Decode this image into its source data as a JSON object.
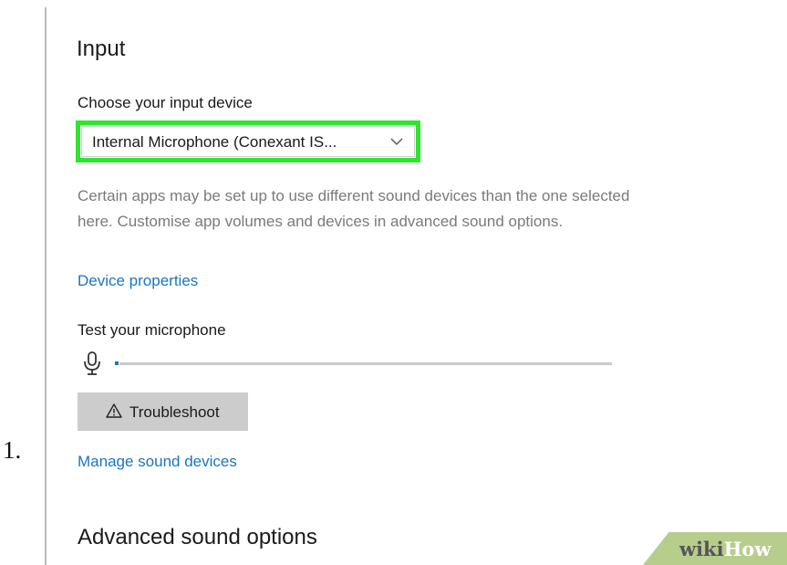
{
  "list_marker": "1.",
  "input_section": {
    "title": "Input",
    "device_label": "Choose your input device",
    "device_value": "Internal Microphone (Conexant IS...",
    "description": "Certain apps may be set up to use different sound devices than the one selected here. Customise app volumes and devices in advanced sound options.",
    "device_properties_link": "Device properties",
    "test_label": "Test your microphone",
    "mic_level_percent": 0,
    "troubleshoot_label": "Troubleshoot",
    "manage_link": "Manage sound devices"
  },
  "advanced_title": "Advanced sound options",
  "watermark": {
    "part1": "wiki",
    "part2": "How"
  },
  "colors": {
    "highlight": "#2ee62e",
    "link": "#1c75bc",
    "button_bg": "#cccccc",
    "muted_text": "#7a7a7a"
  },
  "icons": {
    "chevron": "chevron-down-icon",
    "microphone": "microphone-icon",
    "warning": "warning-icon"
  }
}
